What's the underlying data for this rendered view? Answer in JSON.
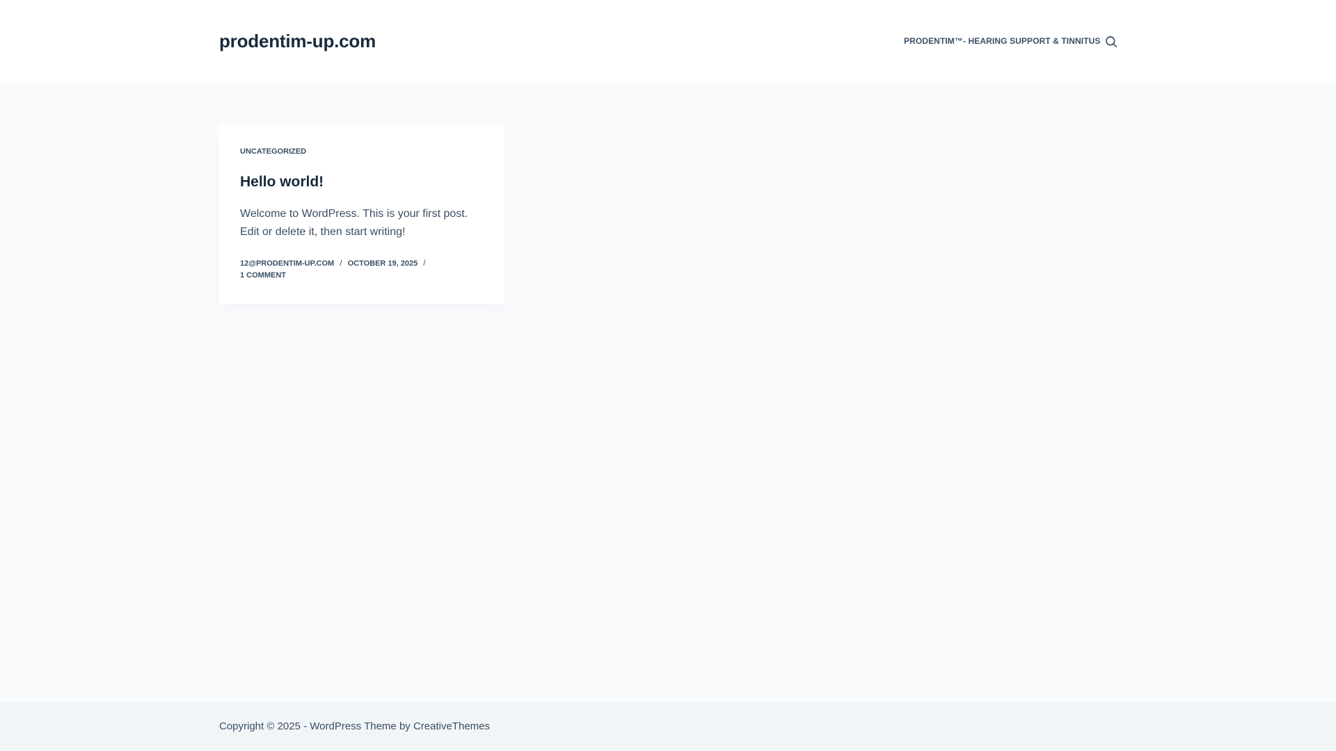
{
  "header": {
    "site_title": "prodentim-up.com",
    "nav": [
      {
        "label": "PRODENTIM™- HEARING SUPPORT & TINNITUS"
      }
    ],
    "search_icon": "search-icon"
  },
  "post": {
    "category": "UNCATEGORIZED",
    "title": "Hello world!",
    "excerpt": "Welcome to WordPress. This is your first post. Edit or delete it, then start writing!",
    "meta": {
      "author": "12@PRODENTIM-UP.COM",
      "date": "OCTOBER 19, 2025",
      "separator": "/",
      "comments": "1 COMMENT"
    }
  },
  "footer": {
    "prefix": "Copyright © 2025 - WordPress Theme by ",
    "link": "CreativeThemes"
  },
  "colors": {
    "heading": "#192a3d",
    "text": "#3a4f66",
    "page_background": "#f9fafc",
    "footer_background": "#f2f5f7"
  }
}
